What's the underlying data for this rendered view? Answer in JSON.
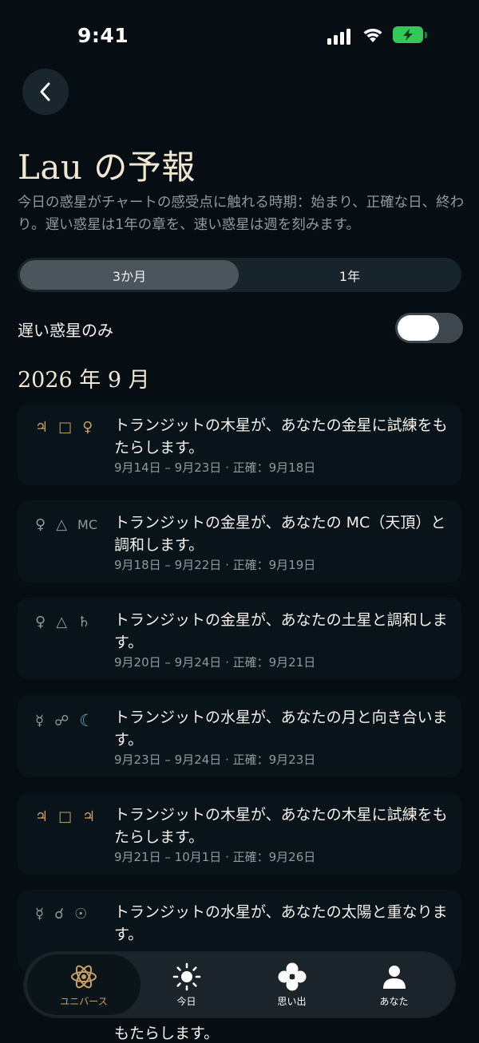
{
  "status": {
    "time": "9:41"
  },
  "header": {
    "title": "Lau の予報",
    "subtitle": "今日の惑星がチャートの感受点に触れる時期：始まり、正確な日、終わり。遅い惑星は1年の章を、速い惑星は週を刻みます。"
  },
  "segmented": {
    "options": [
      "3か月",
      "1年"
    ],
    "selected": "3か月"
  },
  "toggle": {
    "label": "遅い惑星のみ",
    "on": false
  },
  "section": {
    "month": "2026 年 9 月"
  },
  "transits": [
    {
      "glyphs": [
        "♃",
        "□",
        "♀"
      ],
      "text": "トランジットの木星が、あなたの金星に試練をもたらします。",
      "dates": "9月14日 – 9月23日 · 正確：9月18日"
    },
    {
      "glyphs": [
        "♀",
        "△",
        "MC"
      ],
      "text": "トランジットの金星が、あなたの MC（天頂）と調和します。",
      "dates": "9月18日 – 9月22日 · 正確：9月19日"
    },
    {
      "glyphs": [
        "♀",
        "△",
        "♄"
      ],
      "text": "トランジットの金星が、あなたの土星と調和します。",
      "dates": "9月20日 – 9月24日 · 正確：9月21日"
    },
    {
      "glyphs": [
        "☿",
        "☍",
        "☾"
      ],
      "text": "トランジットの水星が、あなたの月と向き合います。",
      "dates": "9月23日 – 9月24日 · 正確：9月23日"
    },
    {
      "glyphs": [
        "♃",
        "□",
        "♃"
      ],
      "text": "トランジットの木星が、あなたの木星に試練をもたらします。",
      "dates": "9月21日 – 10月1日 · 正確：9月26日"
    },
    {
      "glyphs": [
        "☿",
        "☌",
        "☉"
      ],
      "text": "トランジットの水星が、あなたの太陽と重なります。",
      "dates": ""
    }
  ],
  "partial_text": "もたらします。",
  "tabbar": {
    "items": [
      {
        "label": "ユニバース",
        "icon": "atom-icon",
        "active": true
      },
      {
        "label": "今日",
        "icon": "sun-icon",
        "active": false
      },
      {
        "label": "思い出",
        "icon": "flower-icon",
        "active": false
      },
      {
        "label": "あなた",
        "icon": "person-icon",
        "active": false
      }
    ]
  },
  "colors": {
    "accent_gold": "#c9a063",
    "moon_teal": "#6fa4b0",
    "background": "#060e14"
  }
}
